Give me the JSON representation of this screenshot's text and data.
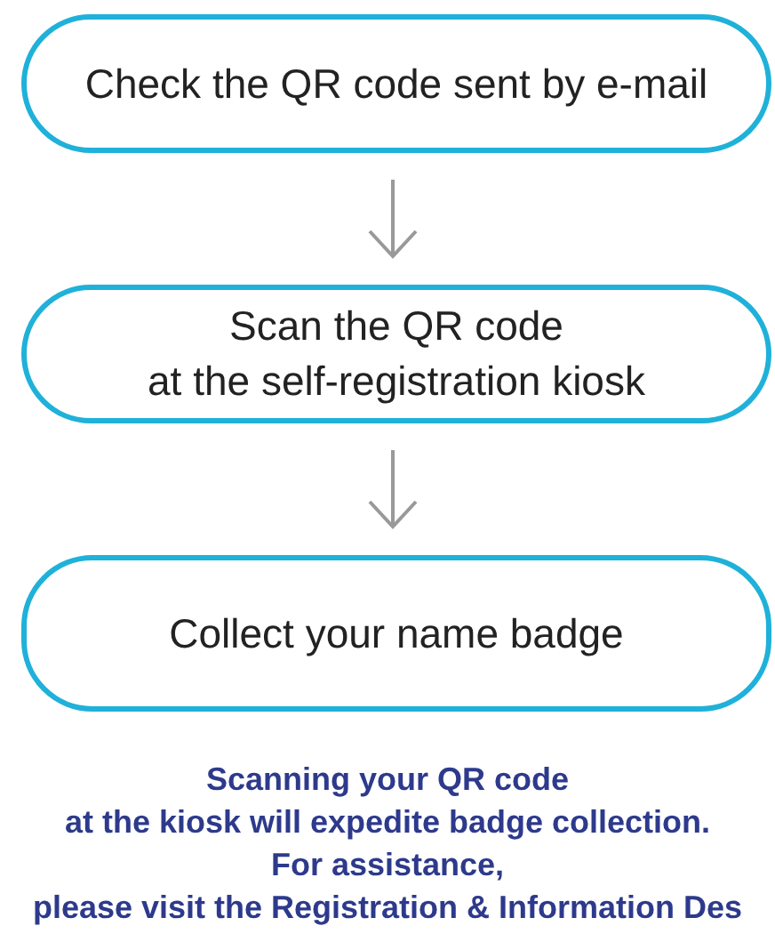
{
  "steps": [
    {
      "lines": [
        "Check the QR code sent by e-mail"
      ]
    },
    {
      "lines": [
        "Scan the QR code",
        "at the self-registration kiosk"
      ]
    },
    {
      "lines": [
        "Collect your name badge"
      ]
    }
  ],
  "note": [
    "Scanning your QR code",
    "at the kiosk will expedite badge collection.",
    "For assistance,",
    "please visit the Registration & Information Des"
  ]
}
